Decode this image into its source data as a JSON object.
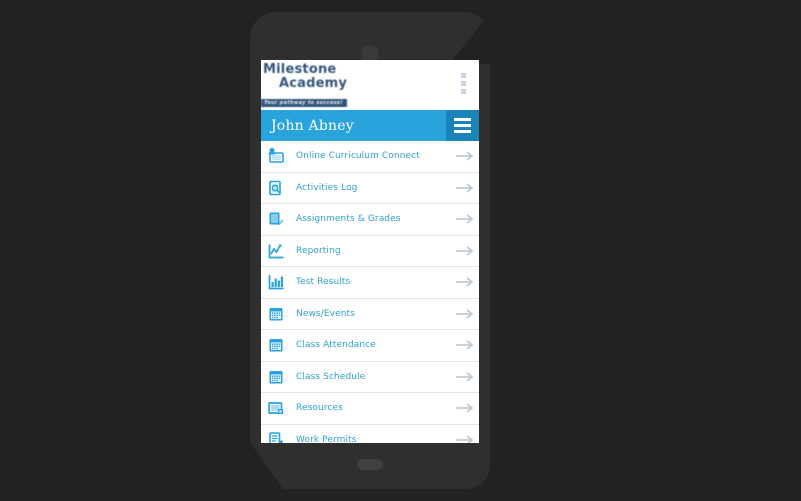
{
  "device": {
    "camera_icon": "camera-dot",
    "home_button_icon": "home-button"
  },
  "brand": {
    "line1": "Milestone",
    "line2": "Academy",
    "tagline": "Your pathway to success!",
    "overflow_icon": "kebab-menu-icon"
  },
  "header": {
    "user_name": "John Abney",
    "menu_icon": "hamburger-icon",
    "bg_color": "#29a3dc",
    "button_color": "#1a83b8"
  },
  "colors": {
    "accent": "#29a3dc",
    "link": "#2e9fd6",
    "brand_navy": "#33557c",
    "page_bg": "#222222",
    "device_body": "#2f2f2f"
  },
  "menu": {
    "arrow_icon": "arrow-right-icon",
    "items": [
      {
        "label": "Online Curriculum Connect",
        "icon": "monitor-icon"
      },
      {
        "label": "Activities Log",
        "icon": "book-search-icon"
      },
      {
        "label": "Assignments & Grades",
        "icon": "notebook-pencil-icon"
      },
      {
        "label": "Reporting",
        "icon": "line-chart-icon"
      },
      {
        "label": "Test Results",
        "icon": "bar-chart-icon"
      },
      {
        "label": "News/Events",
        "icon": "calendar-icon"
      },
      {
        "label": "Class Attendance",
        "icon": "calendar-icon"
      },
      {
        "label": "Class Schedule",
        "icon": "calendar-icon"
      },
      {
        "label": "Resources",
        "icon": "media-icon"
      },
      {
        "label": "Work Permits",
        "icon": "document-pencil-icon"
      }
    ]
  }
}
